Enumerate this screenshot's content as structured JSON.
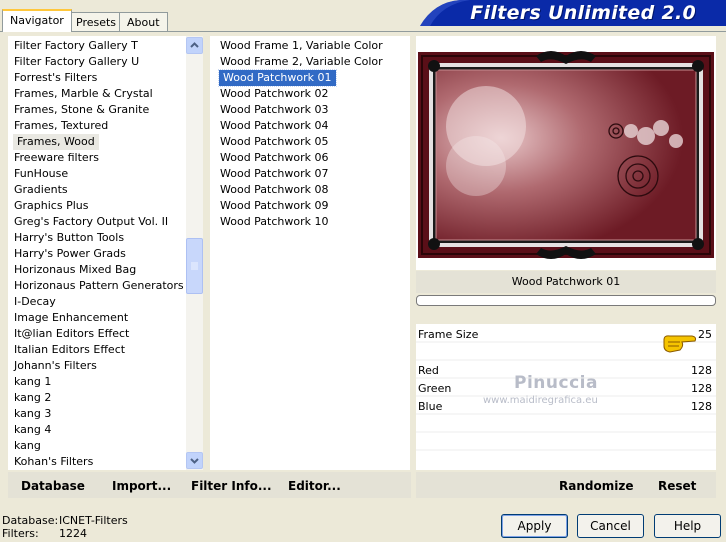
{
  "tabs": [
    "Navigator",
    "Presets",
    "About"
  ],
  "banner_title": "Filters Unlimited 2.0",
  "categories": [
    "Filter Factory Gallery T",
    "Filter Factory Gallery U",
    "Forrest's Filters",
    "Frames, Marble & Crystal",
    "Frames, Stone & Granite",
    "Frames, Textured",
    "Frames, Wood",
    "Freeware filters",
    "FunHouse",
    "Gradients",
    "Graphics Plus",
    "Greg's Factory Output Vol. II",
    "Harry's Button Tools",
    "Harry's Power Grads",
    "Horizonaus Mixed Bag",
    "Horizonaus Pattern Generators",
    "I-Decay",
    "Image Enhancement",
    "It@lian Editors Effect",
    "Italian Editors Effect",
    "Johann's Filters",
    "kang 1",
    "kang 2",
    "kang 3",
    "kang 4",
    "kang",
    "Kohan's Filters"
  ],
  "selected_category": "Frames, Wood",
  "filters": [
    "Wood Frame 1, Variable Color",
    "Wood Frame 2, Variable Color",
    "Wood Patchwork 01",
    "Wood Patchwork 02",
    "Wood Patchwork 03",
    "Wood Patchwork 04",
    "Wood Patchwork 05",
    "Wood Patchwork 06",
    "Wood Patchwork 07",
    "Wood Patchwork 08",
    "Wood Patchwork 09",
    "Wood Patchwork 10"
  ],
  "selected_filter": "Wood Patchwork 01",
  "preview_name": "Wood Patchwork 01",
  "params": [
    {
      "label": "Frame Size",
      "value": "25"
    },
    {
      "label": "Red",
      "value": "128"
    },
    {
      "label": "Green",
      "value": "128"
    },
    {
      "label": "Blue",
      "value": "128"
    }
  ],
  "watermark": {
    "line1": "Pinuccia",
    "line2": "www.maidiregrafica.eu"
  },
  "toolbar_left": {
    "database": "Database",
    "import": "Import...",
    "filter_info": "Filter Info...",
    "editor": "Editor..."
  },
  "toolbar_right": {
    "randomize": "Randomize",
    "reset": "Reset"
  },
  "status": {
    "database_label": "Database:",
    "database_value": "ICNET-Filters",
    "filters_label": "Filters:",
    "filters_value": "1224"
  },
  "buttons": {
    "apply": "Apply",
    "cancel": "Cancel",
    "help": "Help"
  },
  "colors": {
    "banner": "#0a2aa8",
    "selection": "#316ac5",
    "frame": "#5a0f18"
  }
}
